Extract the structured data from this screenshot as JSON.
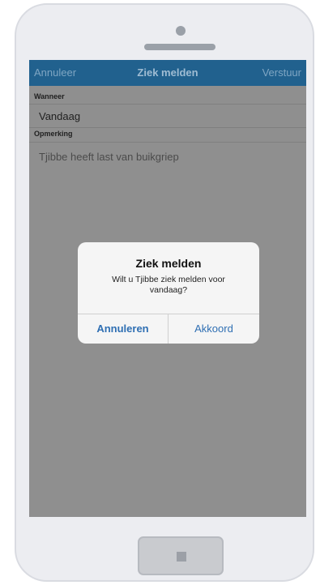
{
  "nav": {
    "cancel": "Annuleer",
    "title": "Ziek melden",
    "send": "Verstuur"
  },
  "form": {
    "when_label": "Wanneer",
    "when_value": "Vandaag",
    "remark_label": "Opmerking",
    "remark_value": "Tjibbe heeft last van buikgriep"
  },
  "alert": {
    "title": "Ziek melden",
    "message_line1": "Wilt u Tjibbe ziek melden voor",
    "message_line2": "vandaag?",
    "cancel_label": "Annuleren",
    "ok_label": "Akkoord"
  },
  "colors": {
    "navbar": "#21618e",
    "overlay": "#8f8f8f",
    "alert_button": "#2f6fb3"
  }
}
